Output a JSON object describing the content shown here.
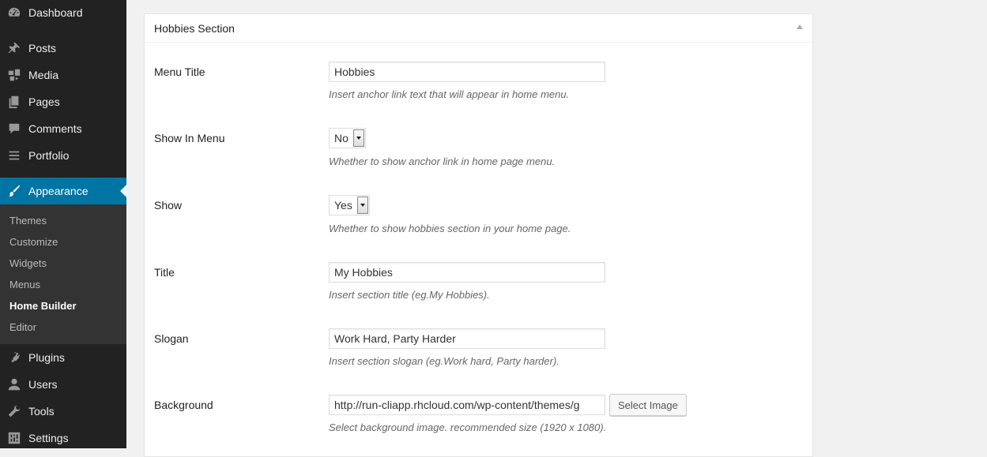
{
  "sidebar": {
    "items": [
      {
        "label": "Dashboard",
        "icon": "dashboard-icon"
      },
      {
        "label": "Posts",
        "icon": "pin-icon"
      },
      {
        "label": "Media",
        "icon": "media-icon"
      },
      {
        "label": "Pages",
        "icon": "pages-icon"
      },
      {
        "label": "Comments",
        "icon": "comment-icon"
      },
      {
        "label": "Portfolio",
        "icon": "list-icon"
      },
      {
        "label": "Appearance",
        "icon": "paintbrush-icon"
      },
      {
        "label": "Plugins",
        "icon": "plug-icon"
      },
      {
        "label": "Users",
        "icon": "user-icon"
      },
      {
        "label": "Tools",
        "icon": "wrench-icon"
      },
      {
        "label": "Settings",
        "icon": "settings-icon"
      }
    ],
    "submenu": [
      {
        "label": "Themes"
      },
      {
        "label": "Customize"
      },
      {
        "label": "Widgets"
      },
      {
        "label": "Menus"
      },
      {
        "label": "Home Builder"
      },
      {
        "label": "Editor"
      }
    ],
    "accent_color": "#0074a2"
  },
  "section": {
    "title": "Hobbies Section",
    "fields": {
      "menu_title": {
        "label": "Menu Title",
        "value": "Hobbies",
        "description": "Insert anchor link text that will appear in home menu."
      },
      "show_in_menu": {
        "label": "Show In Menu",
        "value": "No",
        "description": "Whether to show anchor link in home page menu."
      },
      "show": {
        "label": "Show",
        "value": "Yes",
        "description": "Whether to show hobbies section in your home page."
      },
      "title": {
        "label": "Title",
        "value": "My Hobbies",
        "description": "Insert section title (eg.My Hobbies)."
      },
      "slogan": {
        "label": "Slogan",
        "value": "Work Hard, Party Harder",
        "description": "Insert section slogan (eg.Work hard, Party harder)."
      },
      "background": {
        "label": "Background",
        "value": "http://run-cliapp.rhcloud.com/wp-content/themes/g",
        "button_label": "Select Image",
        "description": "Select background image. recommended size (1920 x 1080)."
      }
    }
  }
}
